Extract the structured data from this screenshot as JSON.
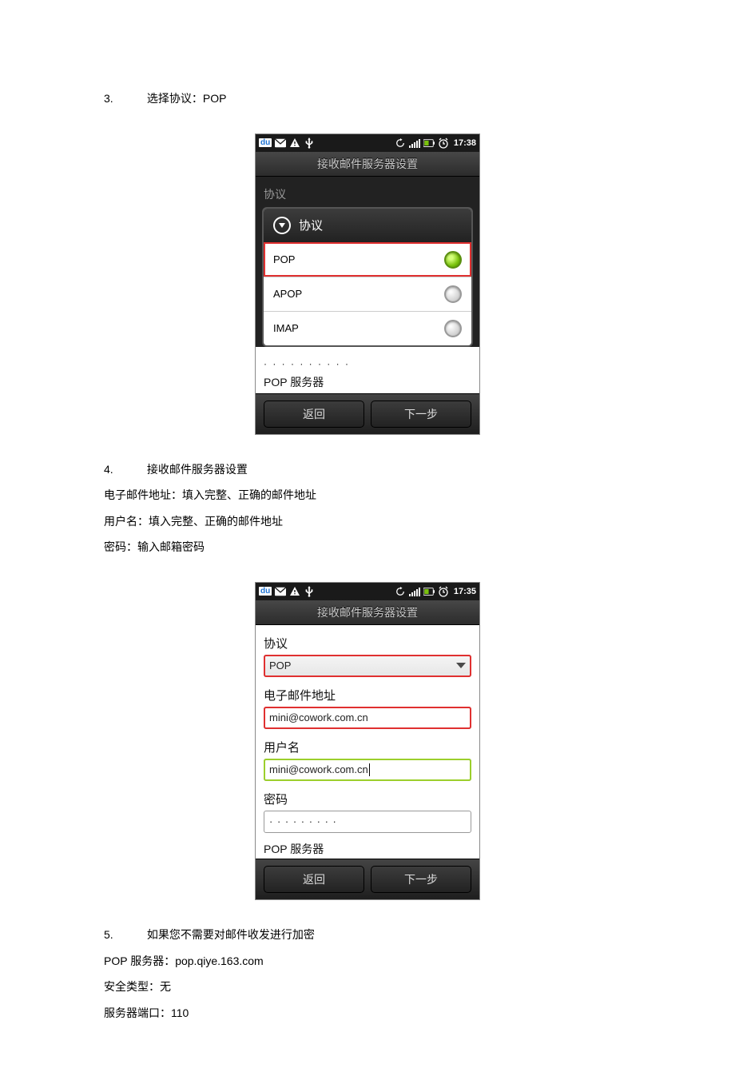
{
  "steps": {
    "s3": {
      "num": "3.",
      "title": "选择协议：POP"
    },
    "s4": {
      "num": "4.",
      "title": "接收邮件服务器设置",
      "l1": "电子邮件地址：填入完整、正确的邮件地址",
      "l2": "用户名：填入完整、正确的邮件地址",
      "l3": "密码：输入邮箱密码"
    },
    "s5": {
      "num": "5.",
      "title": "如果您不需要对邮件收发进行加密",
      "l1": "POP 服务器：pop.qiye.163.com",
      "l2": "安全类型：无",
      "l3": "服务器端口：110"
    }
  },
  "shot1": {
    "statusbar": {
      "time": "17:38",
      "du": "du"
    },
    "title": "接收邮件服务器设置",
    "overlayLabel": "协议",
    "dialogTitle": "协议",
    "options": {
      "o0": "POP",
      "o1": "APOP",
      "o2": "IMAP"
    },
    "afterDots": "· · · · · · · · · ·",
    "partialLabel": "POP 服务器",
    "buttons": {
      "back": "返回",
      "next": "下一步"
    }
  },
  "shot2": {
    "statusbar": {
      "time": "17:35",
      "du": "du"
    },
    "title": "接收邮件服务器设置",
    "labels": {
      "protocol": "协议",
      "email": "电子邮件地址",
      "user": "用户名",
      "password": "密码",
      "partial": "POP 服务器"
    },
    "values": {
      "protocol": "POP",
      "email": "mini@cowork.com.cn",
      "user": "mini@cowork.com.cn",
      "password": "· · · · · · · · ·"
    },
    "buttons": {
      "back": "返回",
      "next": "下一步"
    }
  }
}
